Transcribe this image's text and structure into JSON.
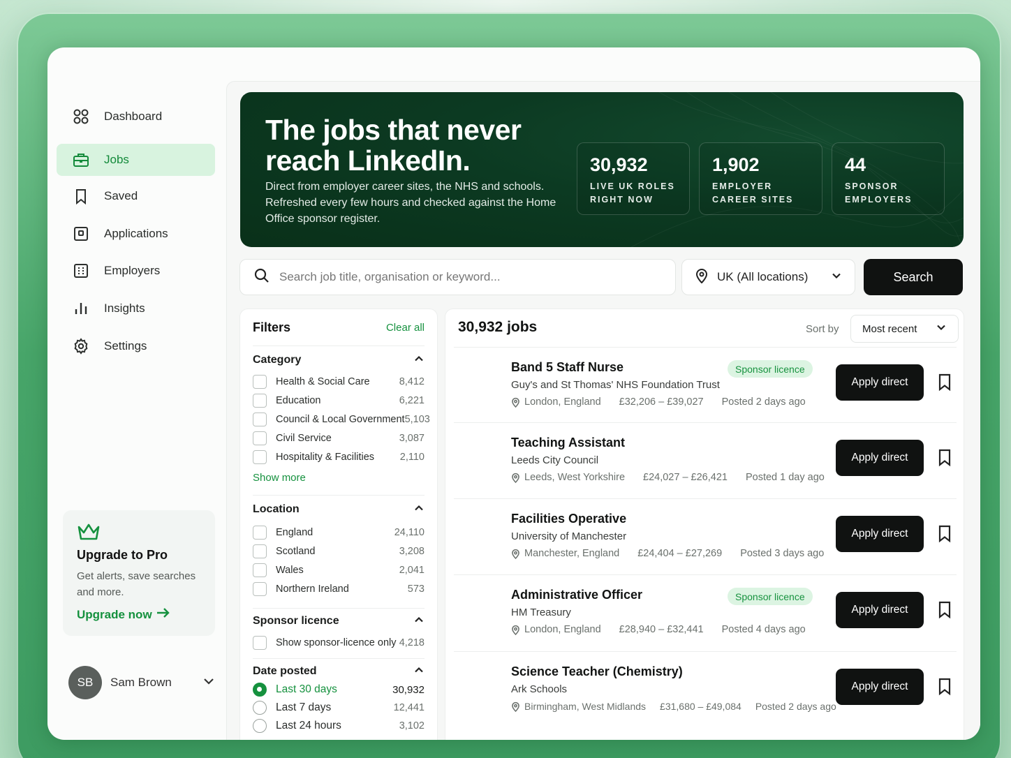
{
  "sidebar": {
    "items": [
      {
        "label": "Dashboard",
        "icon": "dashboard-icon"
      },
      {
        "label": "Jobs",
        "icon": "briefcase-icon",
        "active": true
      },
      {
        "label": "Saved",
        "icon": "bookmark-icon"
      },
      {
        "label": "Applications",
        "icon": "applications-icon"
      },
      {
        "label": "Employers",
        "icon": "building-icon"
      },
      {
        "label": "Insights",
        "icon": "bar-chart-icon"
      },
      {
        "label": "Settings",
        "icon": "gear-icon"
      }
    ],
    "promo": {
      "title": "Upgrade to Pro",
      "description": "Get alerts, save searches and more.",
      "link": "Upgrade now"
    },
    "user": {
      "initials": "SB",
      "name": "Sam Brown"
    }
  },
  "hero": {
    "title": "The jobs that never reach LinkedIn.",
    "description": "Direct from employer career sites, the NHS and schools. Refreshed every few hours and checked against the Home Office sponsor register.",
    "stats": [
      {
        "value": "30,932",
        "label": "LIVE UK ROLES RIGHT NOW"
      },
      {
        "value": "1,902",
        "label": "EMPLOYER CAREER SITES"
      },
      {
        "value": "44",
        "label": "SPONSOR EMPLOYERS"
      }
    ]
  },
  "search": {
    "placeholder": "Search job title, organisation or keyword...",
    "value": "",
    "location": "UK (All locations)",
    "button": "Search"
  },
  "filters": {
    "title": "Filters",
    "clear": "Clear all",
    "category": {
      "title": "Category",
      "options": [
        {
          "label": "Health & Social Care",
          "count": "8,412"
        },
        {
          "label": "Education",
          "count": "6,221"
        },
        {
          "label": "Council & Local Government",
          "count": "5,103"
        },
        {
          "label": "Civil Service",
          "count": "3,087"
        },
        {
          "label": "Hospitality & Facilities",
          "count": "2,110"
        }
      ],
      "show_more": "Show more"
    },
    "location": {
      "title": "Location",
      "options": [
        {
          "label": "England",
          "count": "24,110"
        },
        {
          "label": "Scotland",
          "count": "3,208"
        },
        {
          "label": "Wales",
          "count": "2,041"
        },
        {
          "label": "Northern Ireland",
          "count": "573"
        }
      ]
    },
    "sponsor": {
      "title": "Sponsor licence",
      "options": [
        {
          "label": "Show sponsor-licence only",
          "count": "4,218"
        }
      ]
    },
    "date": {
      "title": "Date posted",
      "options": [
        {
          "label": "Last 30 days",
          "count": "30,932",
          "selected": true
        },
        {
          "label": "Last 7 days",
          "count": "12,441"
        },
        {
          "label": "Last 24 hours",
          "count": "3,102"
        }
      ]
    }
  },
  "results": {
    "count": "30,932 jobs",
    "sort_label": "Sort by",
    "sort_value": "Most recent",
    "apply_label": "Apply direct",
    "jobs": [
      {
        "title": "Band 5 Staff Nurse",
        "org": "Guy's and St Thomas' NHS Foundation Trust",
        "location": "London, England",
        "salary": "£32,206 – £39,027",
        "posted": "Posted 2 days ago",
        "badge": "Sponsor licence"
      },
      {
        "title": "Teaching Assistant",
        "org": "Leeds City Council",
        "location": "Leeds, West Yorkshire",
        "salary": "£24,027 – £26,421",
        "posted": "Posted 1 day ago",
        "badge": ""
      },
      {
        "title": "Facilities Operative",
        "org": "University of Manchester",
        "location": "Manchester, England",
        "salary": "£24,404 – £27,269",
        "posted": "Posted 3 days ago",
        "badge": ""
      },
      {
        "title": "Administrative Officer",
        "org": "HM Treasury",
        "location": "London, England",
        "salary": "£28,940 – £32,441",
        "posted": "Posted 4 days ago",
        "badge": "Sponsor licence"
      },
      {
        "title": "Science Teacher (Chemistry)",
        "org": "Ark Schools",
        "location": "Birmingham, West Midlands",
        "salary": "£31,680 – £49,084",
        "posted": "Posted 2 days ago",
        "badge": ""
      }
    ]
  },
  "colors": {
    "accent": "#15913e",
    "hero_bg": "#0c3a22",
    "button": "#101211",
    "active_bg": "#d8f3df"
  }
}
